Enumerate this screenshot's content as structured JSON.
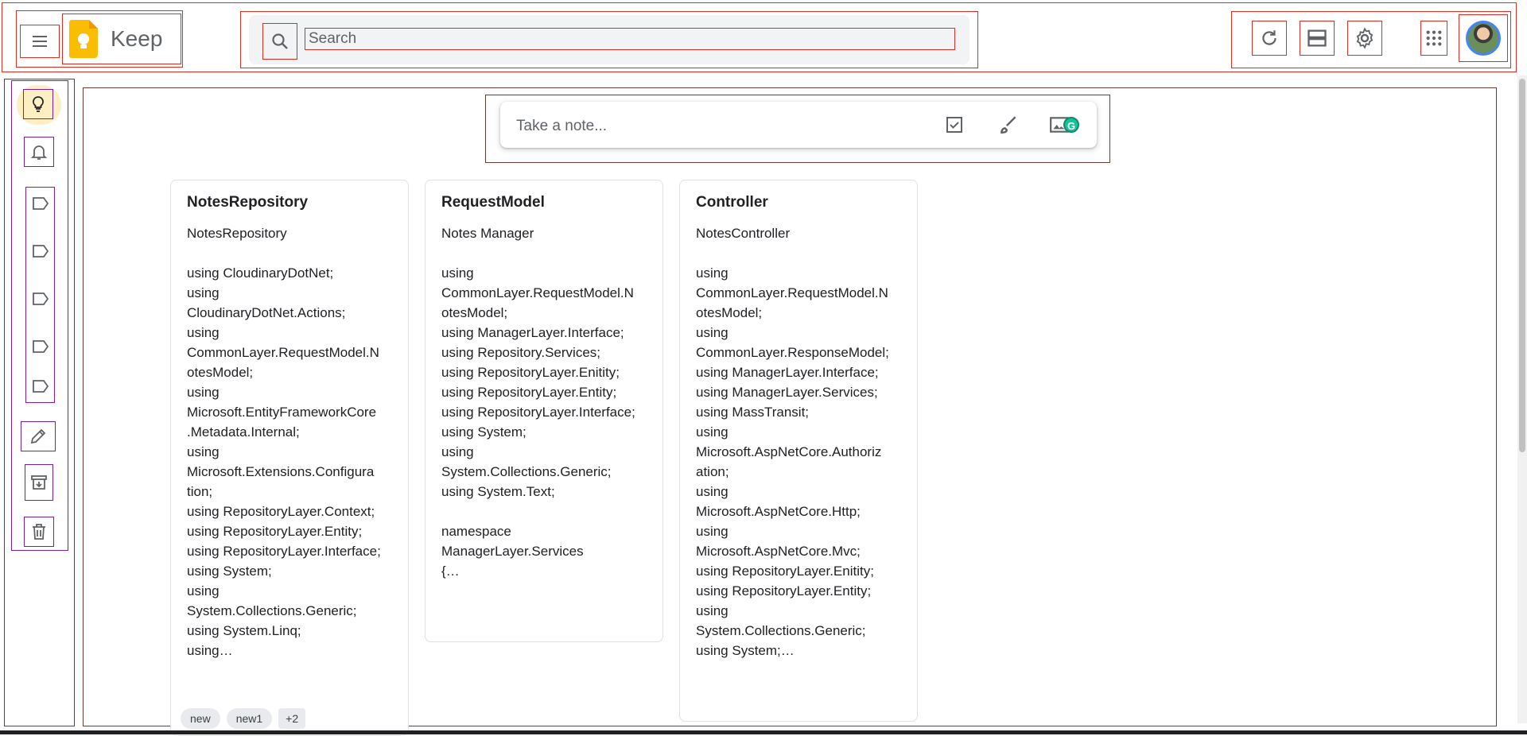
{
  "app": {
    "name": "Keep"
  },
  "header": {
    "menu_icon": "hamburger-menu-icon",
    "logo_icon": "keep-bulb-logo-icon",
    "search": {
      "placeholder": "Search",
      "value": "",
      "icon": "search-icon"
    },
    "right_icons": [
      "refresh-icon",
      "list-view-icon",
      "settings-gear-icon",
      "apps-grid-icon"
    ],
    "avatar": "account-avatar"
  },
  "sidebar": {
    "items": [
      {
        "icon": "lightbulb-icon",
        "active": true
      },
      {
        "icon": "bell-icon",
        "active": false
      },
      {
        "icon": "label-icon",
        "active": false
      },
      {
        "icon": "label-icon",
        "active": false
      },
      {
        "icon": "label-icon",
        "active": false
      },
      {
        "icon": "label-icon",
        "active": false
      },
      {
        "icon": "label-icon",
        "active": false
      },
      {
        "icon": "pencil-edit-icon",
        "active": false
      },
      {
        "icon": "archive-icon",
        "active": false
      },
      {
        "icon": "trash-icon",
        "active": false
      }
    ]
  },
  "take_note": {
    "placeholder": "Take a note...",
    "icons": [
      "checkbox-icon",
      "brush-icon",
      "image-icon"
    ]
  },
  "notes": [
    {
      "title": "NotesRepository",
      "body": "NotesRepository\n\nusing CloudinaryDotNet;\nusing\nCloudinaryDotNet.Actions;\nusing\nCommonLayer.RequestModel.N\notesModel;\nusing\nMicrosoft.EntityFrameworkCore\n.Metadata.Internal;\nusing\nMicrosoft.Extensions.Configura\ntion;\nusing RepositoryLayer.Context;\nusing RepositoryLayer.Entity;\nusing RepositoryLayer.Interface;\nusing System;\nusing\nSystem.Collections.Generic;\nusing System.Linq;\nusing…",
      "labels": [
        "new",
        "new1"
      ],
      "more_labels": "+2"
    },
    {
      "title": "RequestModel",
      "body": "Notes Manager\n\nusing\nCommonLayer.RequestModel.N\notesModel;\nusing ManagerLayer.Interface;\nusing Repository.Services;\nusing RepositoryLayer.Enitity;\nusing RepositoryLayer.Entity;\nusing RepositoryLayer.Interface;\nusing System;\nusing\nSystem.Collections.Generic;\nusing System.Text;\n\nnamespace\nManagerLayer.Services\n{…"
    },
    {
      "title": "Controller",
      "body": "NotesController\n\nusing\nCommonLayer.RequestModel.N\notesModel;\nusing\nCommonLayer.ResponseModel;\nusing ManagerLayer.Interface;\nusing ManagerLayer.Services;\nusing MassTransit;\nusing\nMicrosoft.AspNetCore.Authoriz\nation;\nusing\nMicrosoft.AspNetCore.Http;\nusing\nMicrosoft.AspNetCore.Mvc;\nusing RepositoryLayer.Enitity;\nusing RepositoryLayer.Entity;\nusing\nSystem.Collections.Generic;\nusing System;…"
    }
  ],
  "colors": {
    "accent_active": "#feefc3",
    "logo_yellow": "#fbbc04",
    "grammarly_green": "#15c39a"
  }
}
